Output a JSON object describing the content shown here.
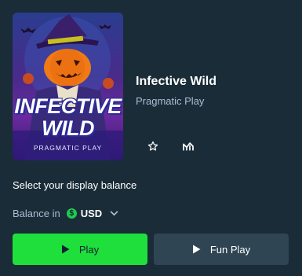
{
  "game": {
    "title": "Infective Wild",
    "provider": "Pragmatic Play",
    "thumbnail": {
      "title_line1": "INFECTIVE",
      "title_line2": "WILD",
      "subtitle": "PRAGMATIC PLAY"
    }
  },
  "actions": {
    "favorite_icon": "star-icon",
    "stats_icon": "stats-icon"
  },
  "balance": {
    "prompt": "Select your display balance",
    "label": "Balance in",
    "currency_symbol": "$",
    "currency_code": "USD"
  },
  "buttons": {
    "play_label": "Play",
    "fun_play_label": "Fun Play"
  },
  "colors": {
    "background": "#1a2c38",
    "play_button": "#1fdf3c",
    "fun_button": "#2f4553",
    "currency_badge": "#1fcb4f"
  }
}
